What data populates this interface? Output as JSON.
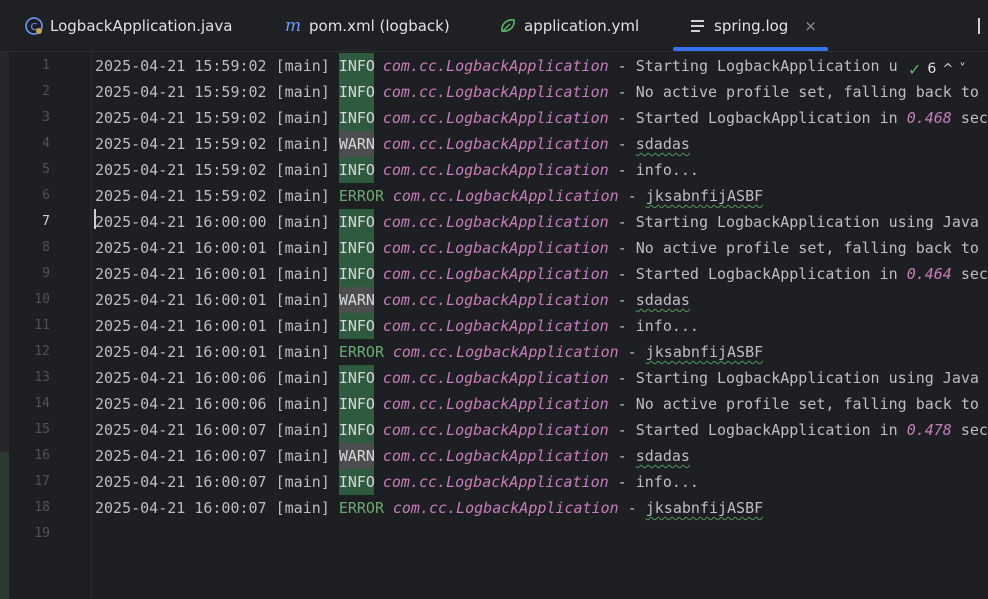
{
  "tabs": [
    {
      "label": "LogbackApplication.java",
      "icon": "java-class-icon",
      "active": false
    },
    {
      "label": "pom.xml (logback)",
      "icon": "maven-icon",
      "active": false
    },
    {
      "label": "application.yml",
      "icon": "spring-yaml-icon",
      "active": false
    },
    {
      "label": "spring.log",
      "icon": "text-file-icon",
      "active": true
    }
  ],
  "tab_close_glyph": "×",
  "inspections": {
    "count": "6",
    "up": "^",
    "down": "˅"
  },
  "current_line": 7,
  "colors": {
    "info_bg": "#2f5a3d",
    "warn_bg": "#4c4d4f",
    "error_fg": "#6aab73",
    "logger": "#c77dbb",
    "accent": "#3574f0"
  },
  "log_lines": [
    {
      "n": "1",
      "ts": "2025-04-21 15:59:02",
      "thread": "[main]",
      "level": "INFO",
      "logger": "com.cc.LogbackApplication",
      "sep": " - ",
      "msg_pre": "Starting LogbackApplication u",
      "msg_num": "",
      "msg_post": ""
    },
    {
      "n": "2",
      "ts": "2025-04-21 15:59:02",
      "thread": "[main]",
      "level": "INFO",
      "logger": "com.cc.LogbackApplication",
      "sep": " - ",
      "msg_pre": "No active profile set, falling back to",
      "msg_num": "",
      "msg_post": ""
    },
    {
      "n": "3",
      "ts": "2025-04-21 15:59:02",
      "thread": "[main]",
      "level": "INFO",
      "logger": "com.cc.LogbackApplication",
      "sep": " - ",
      "msg_pre": "Started LogbackApplication in ",
      "msg_num": "0.468",
      "msg_post": " sec"
    },
    {
      "n": "4",
      "ts": "2025-04-21 15:59:02",
      "thread": "[main]",
      "level": "WARN",
      "logger": "com.cc.LogbackApplication",
      "sep": " - ",
      "msg_pre": "sdadas",
      "msg_num": "",
      "msg_post": ""
    },
    {
      "n": "5",
      "ts": "2025-04-21 15:59:02",
      "thread": "[main]",
      "level": "INFO",
      "logger": "com.cc.LogbackApplication",
      "sep": " - ",
      "msg_pre": "info...",
      "msg_num": "",
      "msg_post": ""
    },
    {
      "n": "6",
      "ts": "2025-04-21 15:59:02",
      "thread": "[main]",
      "level": "ERROR",
      "logger": "com.cc.LogbackApplication",
      "sep": " - ",
      "msg_pre": "jksabnfijASBF",
      "msg_num": "",
      "msg_post": ""
    },
    {
      "n": "7",
      "ts": "2025-04-21 16:00:00",
      "thread": "[main]",
      "level": "INFO",
      "logger": "com.cc.LogbackApplication",
      "sep": " - ",
      "msg_pre": "Starting LogbackApplication using Java",
      "msg_num": "",
      "msg_post": ""
    },
    {
      "n": "8",
      "ts": "2025-04-21 16:00:01",
      "thread": "[main]",
      "level": "INFO",
      "logger": "com.cc.LogbackApplication",
      "sep": " - ",
      "msg_pre": "No active profile set, falling back to",
      "msg_num": "",
      "msg_post": ""
    },
    {
      "n": "9",
      "ts": "2025-04-21 16:00:01",
      "thread": "[main]",
      "level": "INFO",
      "logger": "com.cc.LogbackApplication",
      "sep": " - ",
      "msg_pre": "Started LogbackApplication in ",
      "msg_num": "0.464",
      "msg_post": " sec"
    },
    {
      "n": "10",
      "ts": "2025-04-21 16:00:01",
      "thread": "[main]",
      "level": "WARN",
      "logger": "com.cc.LogbackApplication",
      "sep": " - ",
      "msg_pre": "sdadas",
      "msg_num": "",
      "msg_post": ""
    },
    {
      "n": "11",
      "ts": "2025-04-21 16:00:01",
      "thread": "[main]",
      "level": "INFO",
      "logger": "com.cc.LogbackApplication",
      "sep": " - ",
      "msg_pre": "info...",
      "msg_num": "",
      "msg_post": ""
    },
    {
      "n": "12",
      "ts": "2025-04-21 16:00:01",
      "thread": "[main]",
      "level": "ERROR",
      "logger": "com.cc.LogbackApplication",
      "sep": " - ",
      "msg_pre": "jksabnfijASBF",
      "msg_num": "",
      "msg_post": ""
    },
    {
      "n": "13",
      "ts": "2025-04-21 16:00:06",
      "thread": "[main]",
      "level": "INFO",
      "logger": "com.cc.LogbackApplication",
      "sep": " - ",
      "msg_pre": "Starting LogbackApplication using Java",
      "msg_num": "",
      "msg_post": ""
    },
    {
      "n": "14",
      "ts": "2025-04-21 16:00:06",
      "thread": "[main]",
      "level": "INFO",
      "logger": "com.cc.LogbackApplication",
      "sep": " - ",
      "msg_pre": "No active profile set, falling back to",
      "msg_num": "",
      "msg_post": ""
    },
    {
      "n": "15",
      "ts": "2025-04-21 16:00:07",
      "thread": "[main]",
      "level": "INFO",
      "logger": "com.cc.LogbackApplication",
      "sep": " - ",
      "msg_pre": "Started LogbackApplication in ",
      "msg_num": "0.478",
      "msg_post": " sec"
    },
    {
      "n": "16",
      "ts": "2025-04-21 16:00:07",
      "thread": "[main]",
      "level": "WARN",
      "logger": "com.cc.LogbackApplication",
      "sep": " - ",
      "msg_pre": "sdadas",
      "msg_num": "",
      "msg_post": ""
    },
    {
      "n": "17",
      "ts": "2025-04-21 16:00:07",
      "thread": "[main]",
      "level": "INFO",
      "logger": "com.cc.LogbackApplication",
      "sep": " - ",
      "msg_pre": "info...",
      "msg_num": "",
      "msg_post": ""
    },
    {
      "n": "18",
      "ts": "2025-04-21 16:00:07",
      "thread": "[main]",
      "level": "ERROR",
      "logger": "com.cc.LogbackApplication",
      "sep": " - ",
      "msg_pre": "jksabnfijASBF",
      "msg_num": "",
      "msg_post": ""
    }
  ],
  "empty_line_numbers": [
    "19"
  ]
}
